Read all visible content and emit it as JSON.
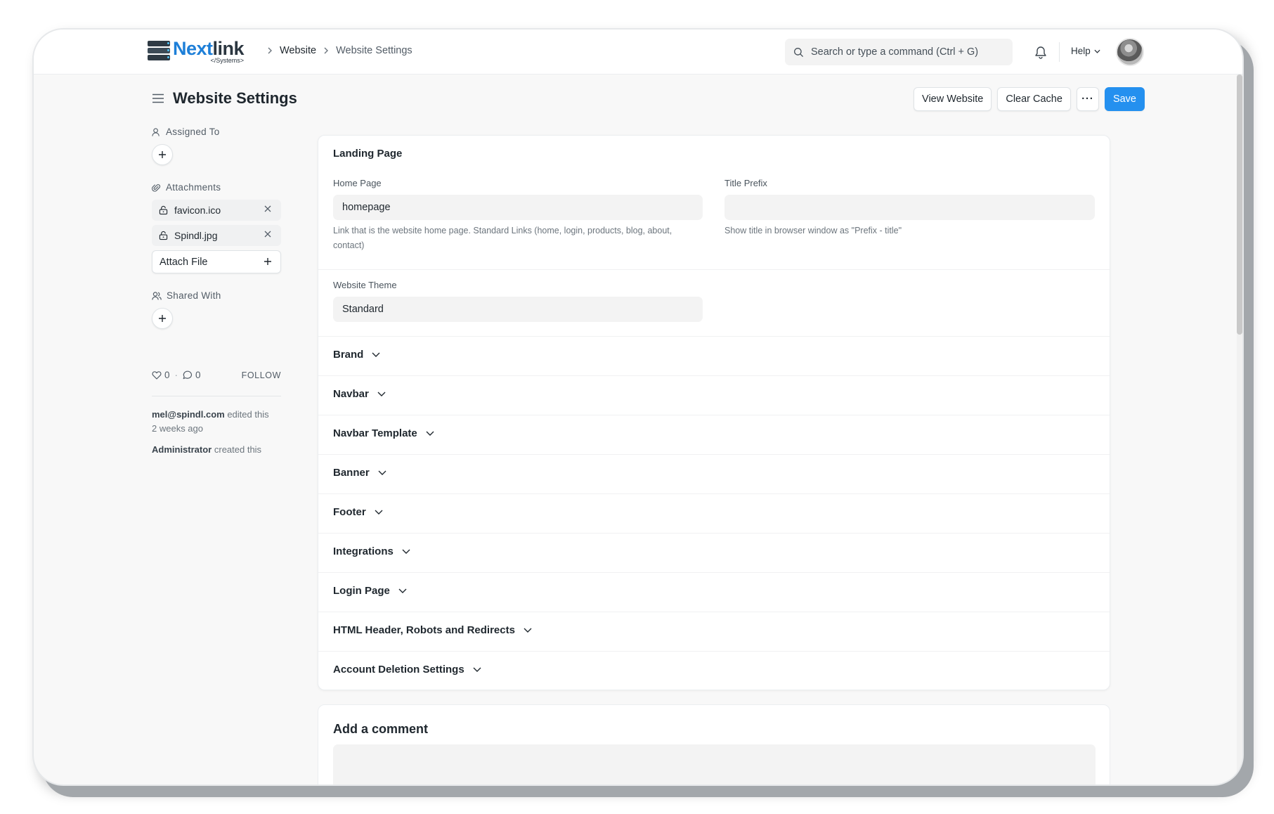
{
  "navbar": {
    "logo": {
      "word_a": "Next",
      "word_b": "link",
      "sub": "</Systems>"
    },
    "breadcrumb": [
      "Website",
      "Website Settings"
    ],
    "search_placeholder": "Search or type a command (Ctrl + G)",
    "help_label": "Help"
  },
  "page": {
    "title": "Website Settings",
    "actions": {
      "view_website": "View Website",
      "clear_cache": "Clear Cache",
      "more": "···",
      "save": "Save"
    }
  },
  "sidebar": {
    "assigned_to_label": "Assigned To",
    "attachments_label": "Attachments",
    "attachments": [
      "favicon.ico",
      "Spindl.jpg"
    ],
    "attach_file_label": "Attach File",
    "shared_with_label": "Shared With",
    "likes": "0",
    "comments": "0",
    "stat_separator": "·",
    "follow_label": "FOLLOW",
    "activity": [
      {
        "user": "mel@spindl.com",
        "text": "edited this",
        "time": "2 weeks ago"
      },
      {
        "user": "Administrator",
        "text": "created this",
        "time": ""
      }
    ]
  },
  "form": {
    "landing_page_title": "Landing Page",
    "home_page": {
      "label": "Home Page",
      "value": "homepage",
      "help": "Link that is the website home page. Standard Links (home, login, products, blog, about, contact)"
    },
    "title_prefix": {
      "label": "Title Prefix",
      "value": "",
      "help": "Show title in browser window as \"Prefix - title\""
    },
    "website_theme": {
      "label": "Website Theme",
      "value": "Standard"
    },
    "sections": [
      "Brand",
      "Navbar",
      "Navbar Template",
      "Banner",
      "Footer",
      "Integrations",
      "Login Page",
      "HTML Header, Robots and Redirects",
      "Account Deletion Settings"
    ]
  },
  "comment": {
    "title": "Add a comment"
  },
  "colors": {
    "primary": "#2490ef",
    "brand_blue": "#1e7fd8",
    "text": "#1f272e",
    "input_bg": "#f3f3f3"
  },
  "icons": [
    "hamburger-icon",
    "search-icon",
    "bell-icon",
    "chevron-down-icon",
    "user-icon",
    "paperclip-icon",
    "lock-icon",
    "close-icon",
    "plus-icon",
    "users-icon",
    "heart-icon",
    "comment-icon"
  ]
}
